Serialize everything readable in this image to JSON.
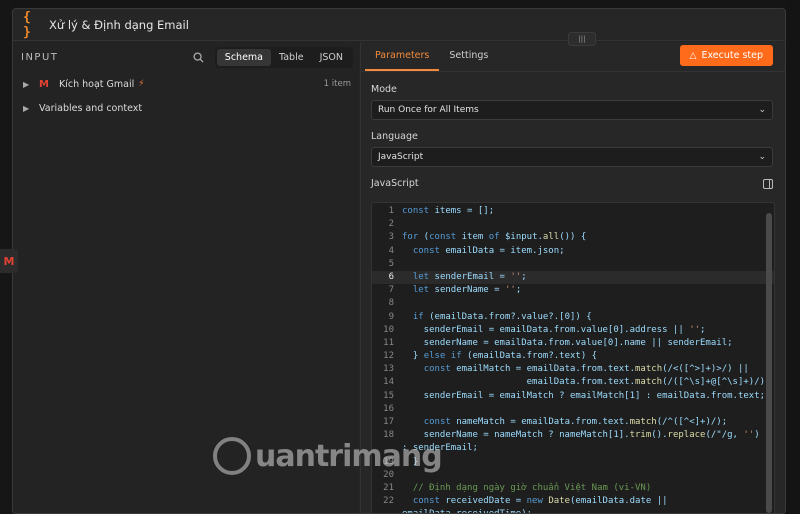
{
  "window": {
    "title": "Xử lý & Định dạng Email"
  },
  "input_panel": {
    "title": "INPUT",
    "view_tabs": [
      {
        "label": "Schema",
        "active": true
      },
      {
        "label": "Table",
        "active": false
      },
      {
        "label": "JSON",
        "active": false
      }
    ],
    "tree": [
      {
        "label": "Kích hoạt Gmail",
        "icon": "gmail-icon",
        "count": "1 item"
      },
      {
        "label": "Variables and context"
      }
    ]
  },
  "params_panel": {
    "tabs": [
      {
        "label": "Parameters",
        "active": true
      },
      {
        "label": "Settings",
        "active": false
      }
    ],
    "execute_label": "Execute step",
    "mode": {
      "label": "Mode",
      "value": "Run Once for All Items"
    },
    "language": {
      "label": "Language",
      "value": "JavaScript"
    },
    "code_label": "JavaScript",
    "code_lines": [
      {
        "n": "1",
        "text": "const items = [];"
      },
      {
        "n": "2",
        "text": ""
      },
      {
        "n": "3",
        "text": "for (const item of $input.all()) {"
      },
      {
        "n": "4",
        "text": "  const emailData = item.json;"
      },
      {
        "n": "5",
        "text": ""
      },
      {
        "n": "6",
        "text": "  let senderEmail = '';"
      },
      {
        "n": "7",
        "text": "  let senderName = '';"
      },
      {
        "n": "8",
        "text": ""
      },
      {
        "n": "9",
        "text": "  if (emailData.from?.value?.[0]) {"
      },
      {
        "n": "10",
        "text": "    senderEmail = emailData.from.value[0].address || '';"
      },
      {
        "n": "11",
        "text": "    senderName = emailData.from.value[0].name || senderEmail;"
      },
      {
        "n": "12",
        "text": "  } else if (emailData.from?.text) {"
      },
      {
        "n": "13",
        "text": "    const emailMatch = emailData.from.text.match(/<([^>]+)>/) ||"
      },
      {
        "n": "14",
        "text": "                       emailData.from.text.match(/([^\\s]+@[^\\s]+)/);"
      },
      {
        "n": "15",
        "text": "    senderEmail = emailMatch ? emailMatch[1] : emailData.from.text;"
      },
      {
        "n": "16",
        "text": ""
      },
      {
        "n": "17",
        "text": "    const nameMatch = emailData.from.text.match(/^([^<]+)/);"
      },
      {
        "n": "18",
        "text": "    senderName = nameMatch ? nameMatch[1].trim().replace(/\"/g, '')"
      },
      {
        "n": "",
        "text": ": senderEmail;"
      },
      {
        "n": "19",
        "text": "  }"
      },
      {
        "n": "20",
        "text": ""
      },
      {
        "n": "21",
        "text": "  // Định dạng ngày giờ chuẩn Việt Nam (vi-VN)"
      },
      {
        "n": "22",
        "text": "  const receivedDate = new Date(emailData.date ||"
      },
      {
        "n": "",
        "text": "emailData.receivedTime);"
      }
    ],
    "highlighted_line": "6"
  },
  "watermark": {
    "text": "uantrimang"
  }
}
